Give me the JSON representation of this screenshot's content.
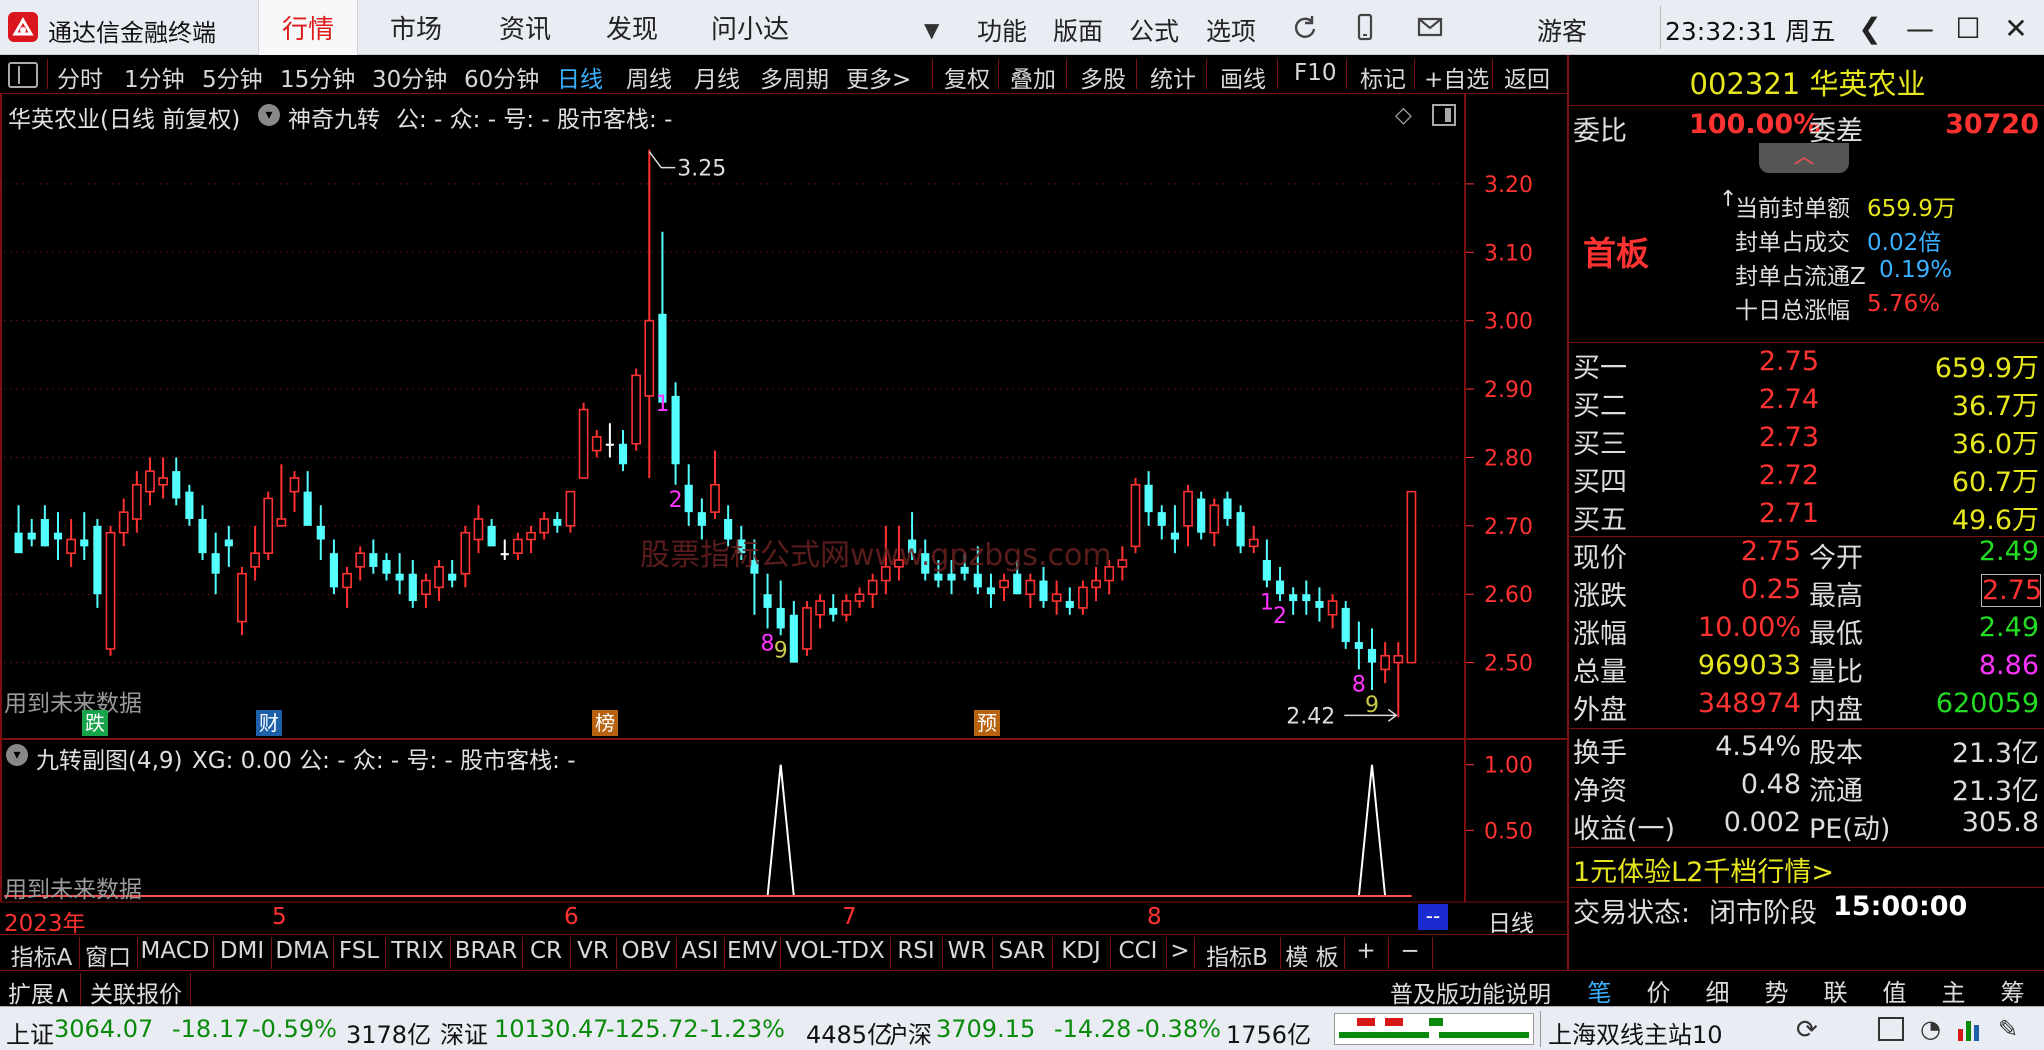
{
  "app": {
    "title": "通达信金融终端"
  },
  "nav": {
    "tabs": [
      "行情",
      "市场",
      "资讯",
      "发现",
      "问小达"
    ],
    "active": "行情"
  },
  "menu": {
    "items": [
      "功能",
      "版面",
      "公式",
      "选项"
    ],
    "guest": "游客"
  },
  "clock": {
    "time": "23:32:31",
    "weekday": "周五"
  },
  "periods": {
    "items": [
      "分时",
      "1分钟",
      "5分钟",
      "15分钟",
      "30分钟",
      "60分钟",
      "日线",
      "周线",
      "月线",
      "多周期",
      "更多>"
    ],
    "active": "日线",
    "tools": [
      "复权",
      "叠加",
      "多股",
      "统计",
      "画线",
      "F10",
      "标记",
      "+自选",
      "返回"
    ]
  },
  "chart_header": {
    "stock": "华英农业(日线 前复权)",
    "indicator": "神奇九转",
    "params": "公: -  众: -  号: -  股市客栈: -"
  },
  "sub_header": {
    "indicator": "九转副图(4,9)",
    "params": "XG: 0.00  公: -  众: -  号: -  股市客栈: -"
  },
  "notes": {
    "future_data": "用到未来数据",
    "high_label": "3.25",
    "low_label": "2.42"
  },
  "event_badges": [
    {
      "text": "跌",
      "color": "#17a34a"
    },
    {
      "text": "财",
      "color": "#1d5fa8"
    },
    {
      "text": "榜",
      "color": "#b8620f"
    },
    {
      "text": "预",
      "color": "#b8620f"
    }
  ],
  "x_axis": {
    "labels": [
      "2023年",
      "5",
      "6",
      "7",
      "8"
    ],
    "tail": "--",
    "period_label": "日线"
  },
  "watermark": "股票指标公式网www.gpzbgs.com",
  "chart_data": {
    "type": "candlestick",
    "ylim": [
      2.4,
      3.27
    ],
    "y_ticks": [
      "3.20",
      "3.10",
      "3.00",
      "2.90",
      "2.80",
      "2.70",
      "2.60",
      "2.50"
    ],
    "sub_ylim": [
      0,
      1.15
    ],
    "sub_y_ticks": [
      "1.00",
      "0.50"
    ],
    "colors": {
      "up": "#ff3232",
      "down": "#54ffff",
      "doji": "#ffffff"
    },
    "candles": [
      [
        2.69,
        2.73,
        2.67,
        2.66
      ],
      [
        2.69,
        2.71,
        2.67,
        2.68
      ],
      [
        2.71,
        2.73,
        2.67,
        2.67
      ],
      [
        2.69,
        2.72,
        2.65,
        2.68
      ],
      [
        2.66,
        2.71,
        2.64,
        2.68
      ],
      [
        2.68,
        2.72,
        2.65,
        2.67
      ],
      [
        2.7,
        2.71,
        2.58,
        2.6
      ],
      [
        2.52,
        2.7,
        2.51,
        2.69
      ],
      [
        2.69,
        2.74,
        2.67,
        2.72
      ],
      [
        2.71,
        2.78,
        2.69,
        2.76
      ],
      [
        2.75,
        2.8,
        2.73,
        2.78
      ],
      [
        2.76,
        2.8,
        2.74,
        2.77
      ],
      [
        2.78,
        2.8,
        2.73,
        2.74
      ],
      [
        2.75,
        2.76,
        2.7,
        2.71
      ],
      [
        2.71,
        2.73,
        2.65,
        2.66
      ],
      [
        2.66,
        2.69,
        2.6,
        2.63
      ],
      [
        2.68,
        2.7,
        2.64,
        2.67
      ],
      [
        2.56,
        2.64,
        2.54,
        2.63
      ],
      [
        2.64,
        2.7,
        2.62,
        2.66
      ],
      [
        2.66,
        2.75,
        2.65,
        2.74
      ],
      [
        2.7,
        2.79,
        2.7,
        2.71
      ],
      [
        2.75,
        2.78,
        2.72,
        2.77
      ],
      [
        2.75,
        2.78,
        2.7,
        2.7
      ],
      [
        2.7,
        2.73,
        2.65,
        2.68
      ],
      [
        2.66,
        2.68,
        2.6,
        2.61
      ],
      [
        2.61,
        2.64,
        2.58,
        2.63
      ],
      [
        2.64,
        2.67,
        2.62,
        2.66
      ],
      [
        2.66,
        2.68,
        2.63,
        2.64
      ],
      [
        2.65,
        2.66,
        2.62,
        2.63
      ],
      [
        2.63,
        2.66,
        2.6,
        2.62
      ],
      [
        2.63,
        2.65,
        2.58,
        2.59
      ],
      [
        2.6,
        2.63,
        2.58,
        2.62
      ],
      [
        2.61,
        2.65,
        2.59,
        2.64
      ],
      [
        2.63,
        2.65,
        2.61,
        2.62
      ],
      [
        2.63,
        2.7,
        2.61,
        2.69
      ],
      [
        2.68,
        2.73,
        2.66,
        2.71
      ],
      [
        2.7,
        2.71,
        2.67,
        2.67
      ],
      [
        2.66,
        2.68,
        2.65,
        2.66
      ],
      [
        2.66,
        2.69,
        2.65,
        2.68
      ],
      [
        2.68,
        2.7,
        2.66,
        2.69
      ],
      [
        2.69,
        2.72,
        2.68,
        2.71
      ],
      [
        2.71,
        2.72,
        2.69,
        2.7
      ],
      [
        2.7,
        2.75,
        2.69,
        2.75
      ],
      [
        2.77,
        2.88,
        2.77,
        2.87
      ],
      [
        2.81,
        2.84,
        2.8,
        2.83
      ],
      [
        2.82,
        2.85,
        2.8,
        2.82
      ],
      [
        2.82,
        2.84,
        2.78,
        2.79
      ],
      [
        2.82,
        2.93,
        2.81,
        2.92
      ],
      [
        2.89,
        3.25,
        2.77,
        3.0
      ],
      [
        3.01,
        3.13,
        2.9,
        2.88
      ],
      [
        2.89,
        2.91,
        2.76,
        2.79
      ],
      [
        2.76,
        2.79,
        2.7,
        2.72
      ],
      [
        2.72,
        2.74,
        2.68,
        2.7
      ],
      [
        2.72,
        2.81,
        2.71,
        2.76
      ],
      [
        2.71,
        2.73,
        2.67,
        2.68
      ],
      [
        2.68,
        2.7,
        2.65,
        2.66
      ],
      [
        2.65,
        2.68,
        2.57,
        2.63
      ],
      [
        2.6,
        2.63,
        2.55,
        2.58
      ],
      [
        2.58,
        2.62,
        2.54,
        2.55
      ],
      [
        2.57,
        2.59,
        2.5,
        2.5
      ],
      [
        2.52,
        2.59,
        2.51,
        2.58
      ],
      [
        2.57,
        2.6,
        2.55,
        2.59
      ],
      [
        2.58,
        2.6,
        2.56,
        2.57
      ],
      [
        2.57,
        2.6,
        2.56,
        2.59
      ],
      [
        2.59,
        2.61,
        2.58,
        2.6
      ],
      [
        2.6,
        2.63,
        2.58,
        2.62
      ],
      [
        2.62,
        2.7,
        2.6,
        2.64
      ],
      [
        2.64,
        2.7,
        2.62,
        2.65
      ],
      [
        2.68,
        2.72,
        2.65,
        2.66
      ],
      [
        2.66,
        2.68,
        2.62,
        2.63
      ],
      [
        2.63,
        2.65,
        2.61,
        2.62
      ],
      [
        2.63,
        2.65,
        2.6,
        2.62
      ],
      [
        2.64,
        2.66,
        2.62,
        2.63
      ],
      [
        2.63,
        2.67,
        2.6,
        2.61
      ],
      [
        2.61,
        2.63,
        2.58,
        2.6
      ],
      [
        2.61,
        2.63,
        2.59,
        2.62
      ],
      [
        2.63,
        2.65,
        2.6,
        2.6
      ],
      [
        2.6,
        2.63,
        2.58,
        2.62
      ],
      [
        2.62,
        2.64,
        2.58,
        2.59
      ],
      [
        2.59,
        2.62,
        2.57,
        2.6
      ],
      [
        2.59,
        2.61,
        2.57,
        2.58
      ],
      [
        2.58,
        2.62,
        2.57,
        2.61
      ],
      [
        2.61,
        2.64,
        2.59,
        2.62
      ],
      [
        2.62,
        2.65,
        2.6,
        2.64
      ],
      [
        2.64,
        2.67,
        2.62,
        2.65
      ],
      [
        2.67,
        2.77,
        2.66,
        2.76
      ],
      [
        2.76,
        2.78,
        2.7,
        2.72
      ],
      [
        2.72,
        2.73,
        2.68,
        2.7
      ],
      [
        2.69,
        2.73,
        2.66,
        2.68
      ],
      [
        2.7,
        2.76,
        2.67,
        2.75
      ],
      [
        2.74,
        2.75,
        2.68,
        2.69
      ],
      [
        2.69,
        2.74,
        2.67,
        2.73
      ],
      [
        2.74,
        2.75,
        2.7,
        2.71
      ],
      [
        2.72,
        2.73,
        2.66,
        2.67
      ],
      [
        2.67,
        2.7,
        2.66,
        2.68
      ],
      [
        2.65,
        2.68,
        2.61,
        2.62
      ],
      [
        2.62,
        2.64,
        2.59,
        2.6
      ],
      [
        2.6,
        2.61,
        2.57,
        2.59
      ],
      [
        2.6,
        2.62,
        2.57,
        2.59
      ],
      [
        2.59,
        2.61,
        2.56,
        2.58
      ],
      [
        2.57,
        2.6,
        2.55,
        2.59
      ],
      [
        2.58,
        2.59,
        2.52,
        2.53
      ],
      [
        2.53,
        2.56,
        2.49,
        2.52
      ],
      [
        2.52,
        2.55,
        2.46,
        2.5
      ],
      [
        2.49,
        2.53,
        2.47,
        2.51
      ],
      [
        2.5,
        2.53,
        2.42,
        2.51
      ],
      [
        2.5,
        2.75,
        2.5,
        2.75
      ]
    ],
    "nine_turn_marks": [
      {
        "i": 49,
        "n": "1",
        "color": "#ff33ff"
      },
      {
        "i": 50,
        "n": "2",
        "color": "#ff33ff"
      },
      {
        "i": 57,
        "n": "8",
        "color": "#ff33ff"
      },
      {
        "i": 58,
        "n": "9",
        "color": "#c9c94a"
      },
      {
        "i": 95,
        "n": "1",
        "color": "#ff33ff"
      },
      {
        "i": 96,
        "n": "2",
        "color": "#ff33ff"
      },
      {
        "i": 102,
        "n": "8",
        "color": "#ff33ff"
      },
      {
        "i": 103,
        "n": "9",
        "color": "#c9c94a"
      }
    ],
    "signal_spikes": [
      58,
      103
    ]
  },
  "quote": {
    "code": "002321",
    "name": "华英农业",
    "weibi_label": "委比",
    "weibi_value": "100.00%",
    "weicha_label": "委差",
    "weicha_value": "30720",
    "board_label": "首板",
    "seal_rows": [
      {
        "label": "当前封单额",
        "value": "659.9万"
      },
      {
        "label": "封单占成交",
        "value": "0.02倍"
      },
      {
        "label": "封单占流通Z",
        "value": "0.19%"
      },
      {
        "label": "十日总涨幅",
        "value": "5.76%"
      }
    ],
    "bids": [
      {
        "label": "买一",
        "price": "2.75",
        "vol": "659.9万"
      },
      {
        "label": "买二",
        "price": "2.74",
        "vol": "36.7万"
      },
      {
        "label": "买三",
        "price": "2.73",
        "vol": "36.0万"
      },
      {
        "label": "买四",
        "price": "2.72",
        "vol": "60.7万"
      },
      {
        "label": "买五",
        "price": "2.71",
        "vol": "49.6万"
      }
    ],
    "stats": [
      {
        "l1": "现价",
        "v1": "2.75",
        "c1": "#ff3232",
        "l2": "今开",
        "v2": "2.49",
        "c2": "#22dd22"
      },
      {
        "l1": "涨跌",
        "v1": "0.25",
        "c1": "#ff3232",
        "l2": "最高",
        "v2": "2.75",
        "c2": "#ff3232"
      },
      {
        "l1": "涨幅",
        "v1": "10.00%",
        "c1": "#ff3232",
        "l2": "最低",
        "v2": "2.49",
        "c2": "#22dd22"
      },
      {
        "l1": "总量",
        "v1": "969033",
        "c1": "#e6e61e",
        "l2": "量比",
        "v2": "8.86",
        "c2": "#ff33ff"
      },
      {
        "l1": "外盘",
        "v1": "348974",
        "c1": "#ff3232",
        "l2": "内盘",
        "v2": "620059",
        "c2": "#22dd22"
      }
    ],
    "stats2": [
      {
        "l1": "换手",
        "v1": "4.54%",
        "l2": "股本",
        "v2": "21.3亿"
      },
      {
        "l1": "净资",
        "v1": "0.48",
        "l2": "流通",
        "v2": "21.3亿"
      },
      {
        "l1": "收益(一)",
        "v1": "0.002",
        "l2": "PE(动)",
        "v2": "305.8"
      }
    ],
    "l2_promo": "1元体验L2千档行情>",
    "trade_state_label": "交易状态:",
    "trade_state": "闭市阶段",
    "trade_time": "15:00:00"
  },
  "indicator_tabs": [
    "指标A",
    "窗口",
    "MACD",
    "DMI",
    "DMA",
    "FSL",
    "TRIX",
    "BRAR",
    "CR",
    "VR",
    "OBV",
    "ASI",
    "EMV",
    "VOL-TDX",
    "RSI",
    "WR",
    "SAR",
    "KDJ",
    "CCI",
    ">",
    "指标B",
    "模 板",
    "+",
    "−"
  ],
  "expand_bar": {
    "expand": "扩展∧",
    "related": "关联报价",
    "feature": "普及版功能说明"
  },
  "right_tabs": [
    "笔",
    "价",
    "细",
    "势",
    "联",
    "值",
    "主",
    "筹"
  ],
  "status": {
    "sh_label": "上证",
    "sh_index": "3064.07",
    "sh_chg": "-18.17",
    "sh_pct": "-0.59%",
    "sh_amt": "3178亿",
    "sz_label": "深证",
    "sz_index": "10130.47",
    "sz_chg": "-125.72",
    "sz_pct": "-1.23%",
    "sz_amt": "4485亿",
    "hs_label": "沪深",
    "hs_index": "3709.15",
    "hs_chg": "-14.28",
    "hs_pct": "-0.38%",
    "hs_amt": "1756亿",
    "server": "上海双线主站10"
  }
}
